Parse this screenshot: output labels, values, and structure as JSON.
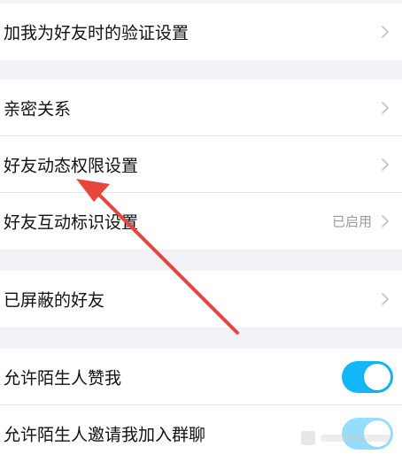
{
  "sections": [
    {
      "rows": [
        {
          "label": "加我为好友时的验证设置",
          "status": "",
          "control": "chevron"
        }
      ]
    },
    {
      "rows": [
        {
          "label": "亲密关系",
          "status": "",
          "control": "chevron"
        },
        {
          "label": "好友动态权限设置",
          "status": "",
          "control": "chevron"
        },
        {
          "label": "好友互动标识设置",
          "status": "已启用",
          "control": "chevron"
        }
      ]
    },
    {
      "rows": [
        {
          "label": "已屏蔽的好友",
          "status": "",
          "control": "chevron"
        }
      ]
    },
    {
      "rows": [
        {
          "label": "允许陌生人赞我",
          "status": "",
          "control": "toggle",
          "on": true
        },
        {
          "label": "允许陌生人邀请我加入群聊",
          "status": "",
          "control": "toggle",
          "on": true
        }
      ]
    }
  ],
  "colors": {
    "background": "#f2f2f6",
    "toggle_on": "#12b7f5",
    "arrow": "#e8453c",
    "chevron": "#c4c4c8"
  },
  "icons": {
    "chevron": "chevron-right-icon",
    "annotation": "red-arrow-annotation"
  }
}
